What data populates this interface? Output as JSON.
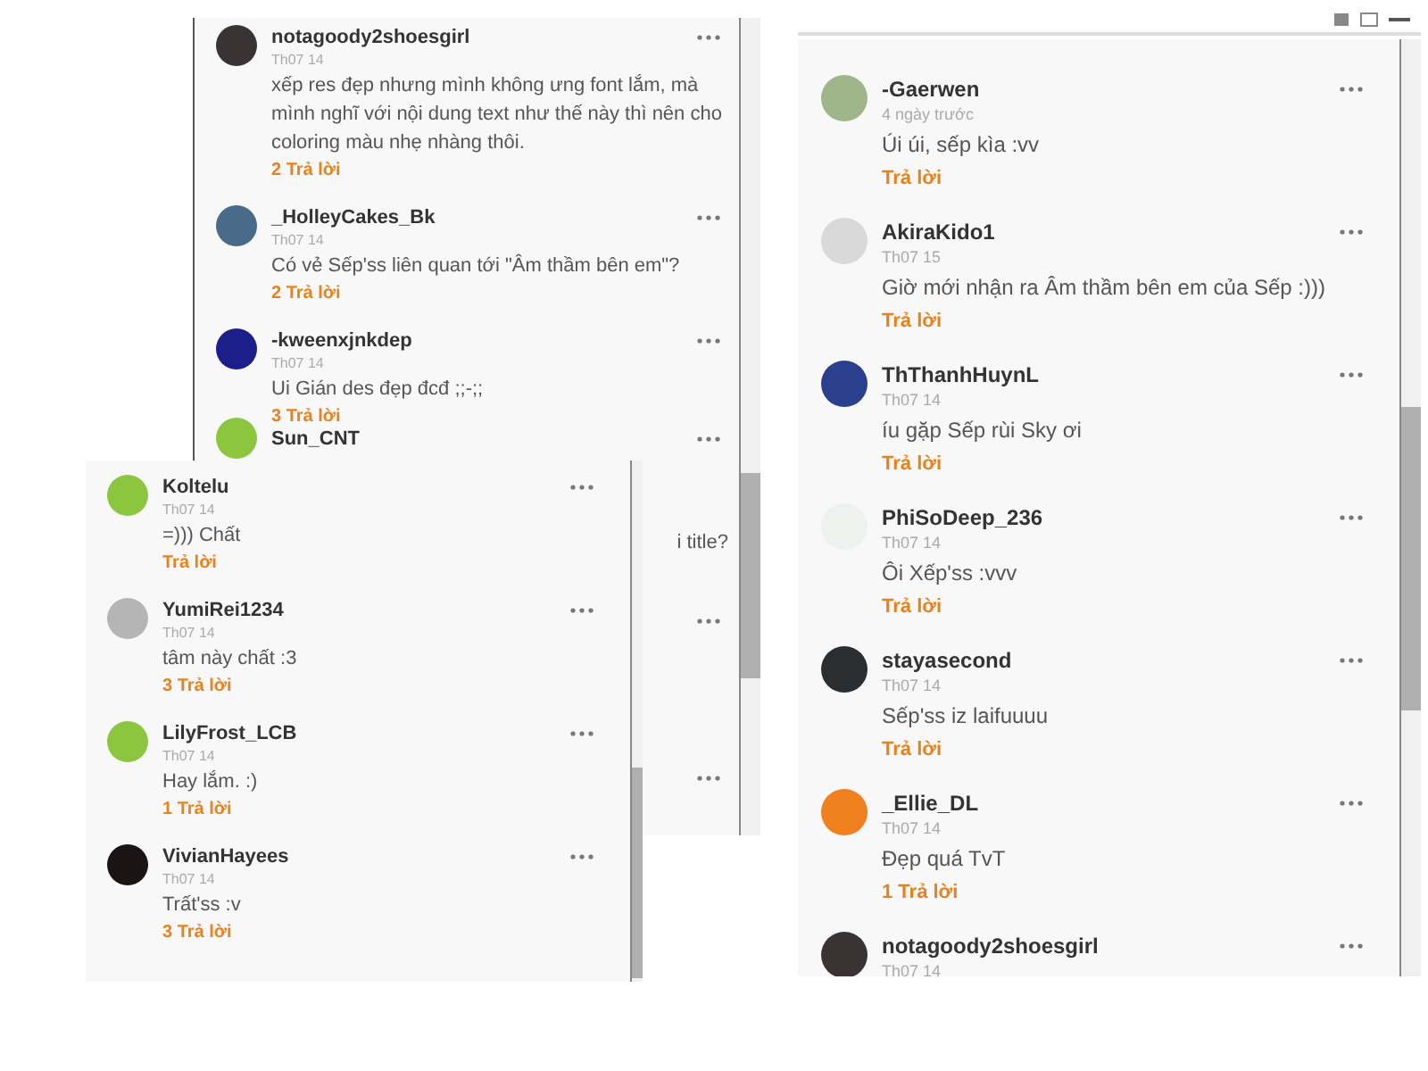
{
  "panels": [
    {
      "comments": [
        {
          "kind": "full",
          "name": "notagoody2shoesgirl",
          "color": "#3a3334",
          "date": "Th07 14",
          "text": "xếp res đẹp nhưng mình không ưng font lắm, mà mình nghĩ với nội dung text như thế này thì nên cho coloring màu nhẹ nhàng thôi.",
          "reply": "2 Trả lời"
        },
        {
          "kind": "full",
          "name": "_HolleyCakes_Bk",
          "color": "#4a6a8a",
          "date": "Th07 14",
          "text": "Có vẻ Sếp'ss liên quan tới \"Âm thầm bên em\"?",
          "reply": "2 Trả lời"
        },
        {
          "kind": "full",
          "name": "-kweenxjnkdep",
          "color": "#1c1f8a",
          "date": "Th07 14",
          "text": "Ui Gián des đẹp đcđ ;;-;;",
          "reply": "3 Trả lời"
        },
        {
          "kind": "partial",
          "name": "Sun_CNT",
          "color": "#8cc63f",
          "text": "i title?"
        }
      ]
    },
    {
      "comments": [
        {
          "kind": "full",
          "name": "Koltelu",
          "color": "#8cc63f",
          "date": "Th07 14",
          "text": "=))) Chất",
          "reply": "Trả lời"
        },
        {
          "kind": "full",
          "name": "YumiRei1234",
          "color": "#b5b5b5",
          "date": "Th07 14",
          "text": "tâm này chất :3",
          "reply": "3 Trả lời"
        },
        {
          "kind": "full",
          "name": "LilyFrost_LCB",
          "color": "#8cc63f",
          "date": "Th07 14",
          "text": "Hay lắm. :)",
          "reply": "1 Trả lời"
        },
        {
          "kind": "full",
          "name": "VivianHayees",
          "color": "#1a1414",
          "date": "Th07 14",
          "text": "Trất'ss :v",
          "reply": "3 Trả lời"
        }
      ]
    },
    {
      "comments": [
        {
          "kind": "full",
          "name": "-Gaerwen",
          "color": "#9fb58a",
          "date": "4 ngày trước",
          "text": "Úi úi, sếp kìa :vv",
          "reply": "Trả lời"
        },
        {
          "kind": "full",
          "name": "AkiraKido1",
          "color": "#d9d9d9",
          "date": "Th07 15",
          "text": "Giờ mới nhận ra Âm thầm bên em của Sếp :)))",
          "reply": "Trả lời"
        },
        {
          "kind": "full",
          "name": "ThThanhHuynL",
          "color": "#2b3f8f",
          "date": "Th07 14",
          "text": "íu gặp Sếp rùi Sky ơi",
          "reply": "Trả lời"
        },
        {
          "kind": "full",
          "name": "PhiSoDeep_236",
          "color": "#eef2ee",
          "date": "Th07 14",
          "text": "Ôi Xếp'ss :vvv",
          "reply": "Trả lời"
        },
        {
          "kind": "full",
          "name": "stayasecond",
          "color": "#2a2e30",
          "date": "Th07 14",
          "text": "Sếp'ss iz laifuuuu",
          "reply": "Trả lời"
        },
        {
          "kind": "full",
          "name": "_Ellie_DL",
          "color": "#f07f1e",
          "date": "Th07 14",
          "text": "Đẹp quá TvT",
          "reply": "1 Trả lời"
        },
        {
          "kind": "cut",
          "name": "notagoody2shoesgirl",
          "color": "#3a3334",
          "date": "Th07 14"
        }
      ]
    }
  ]
}
